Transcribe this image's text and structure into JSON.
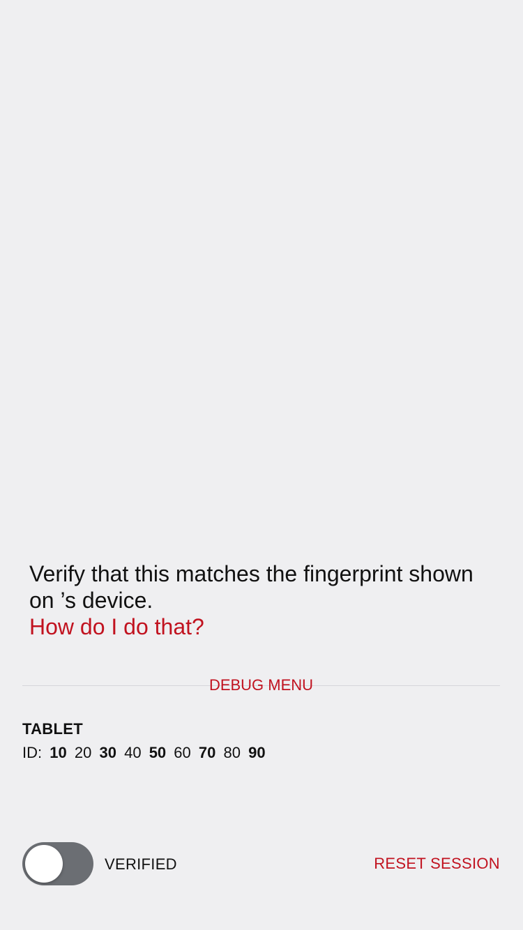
{
  "colors": {
    "background": "#efeff1",
    "accent": "#c1121f",
    "text": "#111111",
    "toggle_off": "#6b6e73",
    "divider": "#d6d6da"
  },
  "instructions": {
    "line1": "Verify that this matches the fingerprint shown",
    "line2": "on ’s device.",
    "help_link": "How do I do that?"
  },
  "debug_menu": {
    "label": "DEBUG MENU"
  },
  "device": {
    "name": "TABLET",
    "id_prefix": "ID:",
    "fingerprint_groups": [
      {
        "text": "10",
        "bold": true
      },
      {
        "text": "20",
        "bold": false
      },
      {
        "text": "30",
        "bold": true
      },
      {
        "text": "40",
        "bold": false
      },
      {
        "text": "50",
        "bold": true
      },
      {
        "text": "60",
        "bold": false
      },
      {
        "text": "70",
        "bold": true
      },
      {
        "text": "80",
        "bold": false
      },
      {
        "text": "90",
        "bold": true
      }
    ]
  },
  "bottom_bar": {
    "verified_toggle_on": false,
    "verified_label": "VERIFIED",
    "reset_label": "RESET SESSION"
  }
}
